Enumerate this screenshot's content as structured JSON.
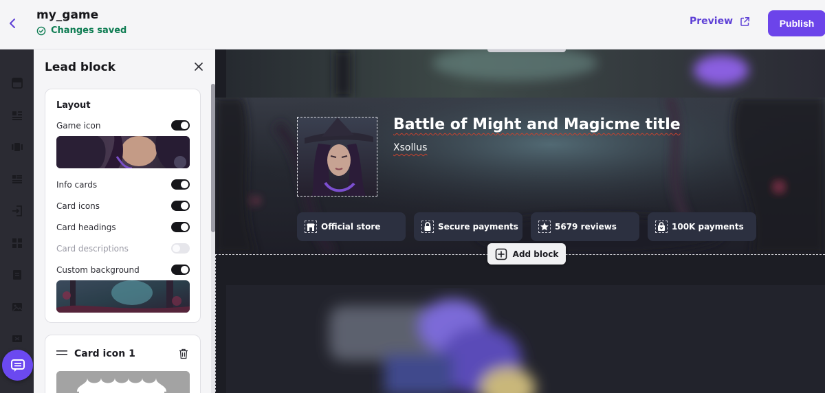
{
  "header": {
    "project_name": "my_game",
    "save_status": "Changes saved",
    "preview_label": "Preview",
    "publish_label": "Publish"
  },
  "panel": {
    "title": "Lead block",
    "layout_heading": "Layout",
    "rows": {
      "game_icon": "Game icon",
      "info_cards": "Info cards",
      "card_icons": "Card icons",
      "card_headings": "Card headings",
      "card_descriptions": "Card descriptions",
      "custom_background": "Custom background"
    },
    "toggles": {
      "game_icon": true,
      "info_cards": true,
      "card_icons": true,
      "card_headings": true,
      "card_descriptions": false,
      "custom_background": true
    },
    "card_icon_title": "Card icon 1"
  },
  "canvas": {
    "game_title": "Battle of Might and Magicme title",
    "publisher": "Xsollus",
    "info_cards": [
      {
        "label": "Official store",
        "icon": "store-icon"
      },
      {
        "label": "Secure payments",
        "icon": "lock-icon"
      },
      {
        "label": "5679 reviews",
        "icon": "star-icon"
      },
      {
        "label": "100K payments",
        "icon": "bag-icon"
      }
    ],
    "add_block_label": "Add block"
  },
  "colors": {
    "accent": "#6c44ea",
    "success": "#0f7d53",
    "rail": "#2b2b33",
    "canvas": "#1c1d24"
  }
}
